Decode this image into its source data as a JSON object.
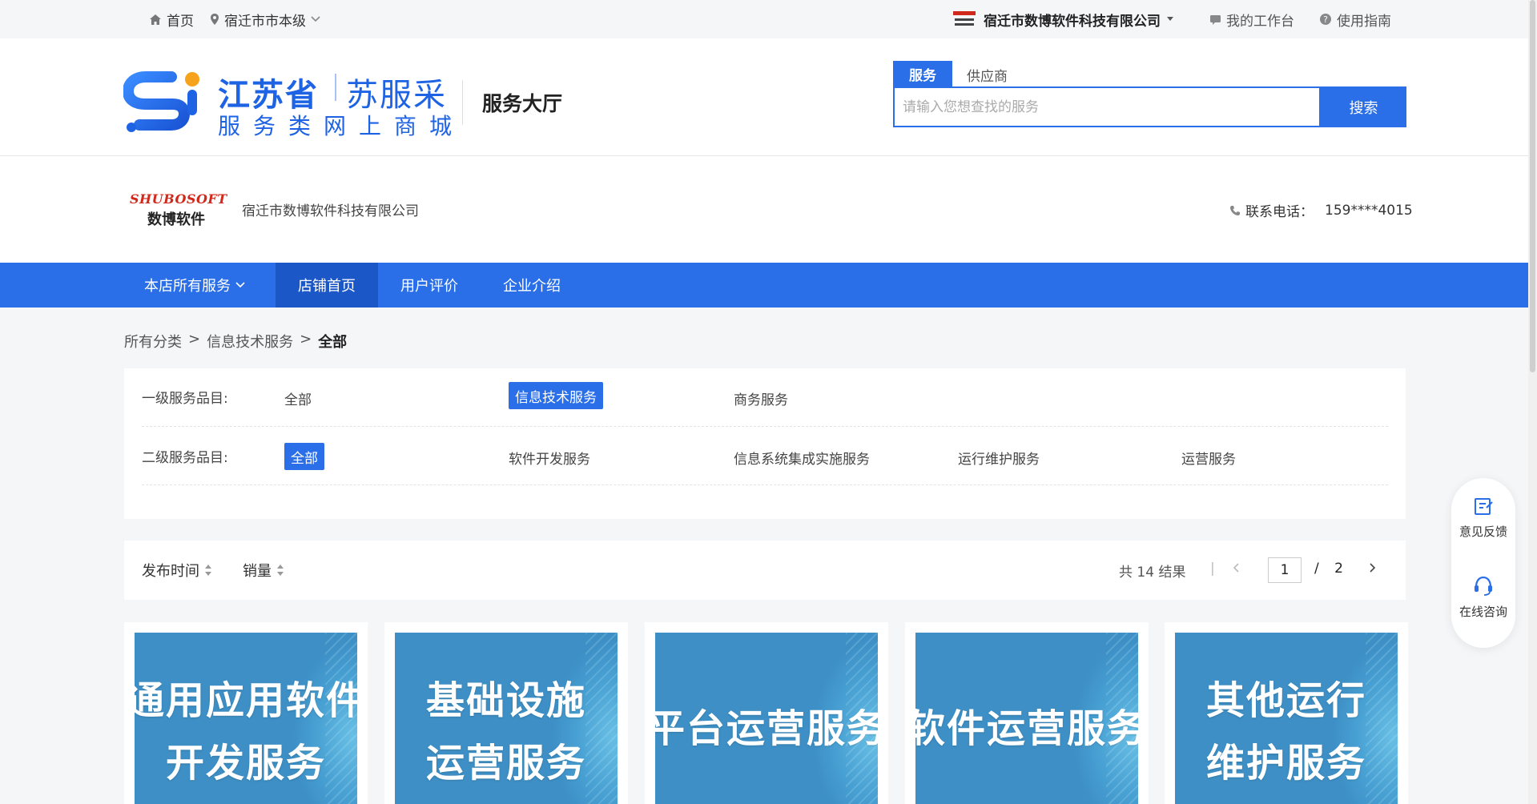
{
  "topbar": {
    "home": "首页",
    "location": "宿迁市市本级",
    "company_logo_text": "SHUBOSOFT 数博软件",
    "company": "宿迁市数博软件科技有限公司",
    "workbench": "我的工作台",
    "guide": "使用指南"
  },
  "header": {
    "logo_title": "江苏省",
    "logo_title2": "苏服采",
    "logo_sub": "服务类网上商城",
    "hall": "服务大厅"
  },
  "search": {
    "tab_active": "服务",
    "tab_other": "供应商",
    "placeholder": "请输入您想查找的服务",
    "button": "搜索"
  },
  "shop": {
    "brand_en": "SHUBOSOFT",
    "brand_cn": "数博软件",
    "name": "宿迁市数博软件科技有限公司",
    "phone_label": "联系电话：",
    "phone": "159****4015"
  },
  "nav": {
    "items": [
      "本店所有服务",
      "店铺首页",
      "用户评价",
      "企业介绍"
    ],
    "active_index": 1
  },
  "breadcrumb": {
    "items": [
      "所有分类",
      "信息技术服务",
      "全部"
    ],
    "sep": ">"
  },
  "filters": {
    "level1_label": "一级服务品目:",
    "level1_options": [
      "全部",
      "信息技术服务",
      "商务服务"
    ],
    "level1_selected": 1,
    "level2_label": "二级服务品目:",
    "level2_options": [
      "全部",
      "软件开发服务",
      "信息系统集成实施服务",
      "运行维护服务",
      "运营服务"
    ],
    "level2_selected": 0
  },
  "sort": {
    "publish_time": "发布时间",
    "sales": "销量",
    "result_text": "共 14 结果",
    "page_current": "1",
    "page_sep": "/",
    "page_total": "2"
  },
  "cards": [
    {
      "line1": "通用应用软件",
      "line2": "开发服务"
    },
    {
      "line1": "基础设施",
      "line2": "运营服务"
    },
    {
      "line1": "平台运营服务",
      "line2": ""
    },
    {
      "line1": "软件运营服务",
      "line2": ""
    },
    {
      "line1": "其他运行",
      "line2": "维护服务"
    }
  ],
  "float": {
    "feedback": "意见反馈",
    "consult": "在线咨询"
  },
  "colors": {
    "primary": "#2a6ee8",
    "nav_active": "#1c57c8",
    "card_bg": "#3d8fc5",
    "brand_red": "#d0281a"
  }
}
